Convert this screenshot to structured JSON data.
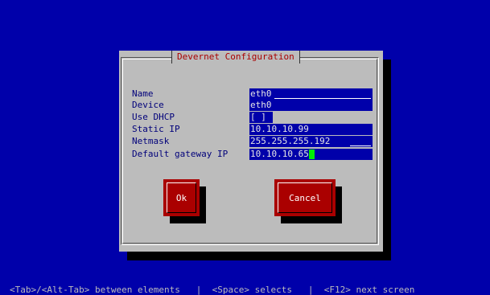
{
  "dialog": {
    "title": "Devernet Configuration"
  },
  "fields": [
    {
      "label": "Name",
      "value": "eth0"
    },
    {
      "label": "Device",
      "value": "eth0"
    },
    {
      "label": "Use DHCP",
      "value": "[ ]"
    },
    {
      "label": "Static IP",
      "value": "10.10.10.99"
    },
    {
      "label": "Netmask",
      "value": "255.255.255.192"
    },
    {
      "label": "Default gateway IP",
      "value": "10.10.10.65"
    }
  ],
  "buttons": {
    "ok_label": "Ok",
    "cancel_label": "Cancel"
  },
  "status_bar": {
    "text": "<Tab>/<Alt-Tab> between elements   |  <Space> selects   |  <F12> next screen"
  },
  "colors": {
    "screen_background": "#0000aa",
    "dialog_background": "#bcbcbc",
    "title_text": "#aa0000",
    "label_text": "#00007a",
    "input_background": "#0000aa",
    "button_background": "#aa0000",
    "cursor": "#00ee00"
  }
}
